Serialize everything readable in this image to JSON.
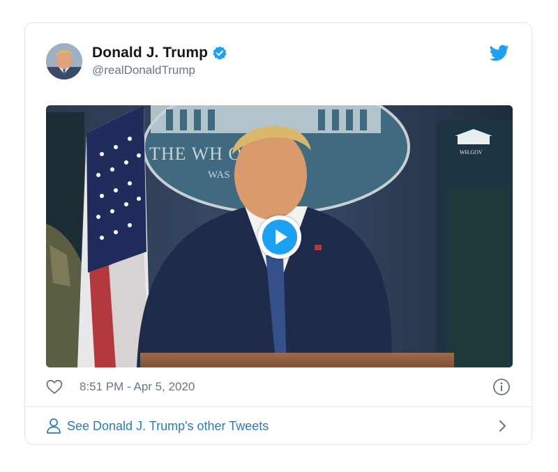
{
  "tweet": {
    "author": {
      "display_name": "Donald J. Trump",
      "handle": "@realDonaldTrump",
      "verified": true
    },
    "media": {
      "type": "video",
      "podium_sign_text": "THE WH    OUSE",
      "podium_sign_subtext": "WAS",
      "corner_logo_text": "WH.GOV",
      "play_icon": "play-icon"
    },
    "timestamp": "8:51 PM - Apr 5, 2020",
    "icons": {
      "like": "heart-icon",
      "info": "info-icon",
      "brand": "twitter-bird-icon",
      "verified": "verified-badge-icon",
      "profile": "person-icon",
      "chevron": "chevron-right-icon"
    },
    "footer_link": "See Donald J. Trump's other Tweets"
  },
  "colors": {
    "twitter_blue": "#1da1f2",
    "link_blue": "#2b7bb9",
    "text_secondary": "#657786",
    "border": "#e1e8ed"
  }
}
